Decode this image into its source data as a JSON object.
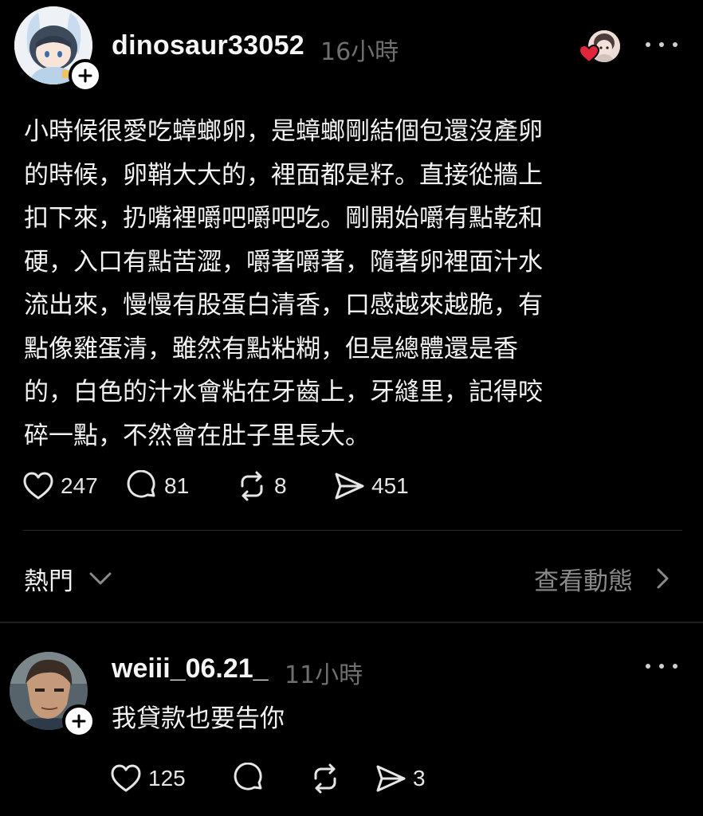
{
  "post": {
    "username": "dinosaur33052",
    "time": "16小時",
    "body": "小時候很愛吃蟑螂卵，是蟑螂剛結個包還沒產卵\n的時候，卵鞘大大的，裡面都是籽。直接從牆上\n扣下來，扔嘴裡嚼吧嚼吧吃。剛開始嚼有點乾和\n硬，入口有點苦澀，嚼著嚼著，隨著卵裡面汁水\n流出來，慢慢有股蛋白清香，口感越來越脆，有\n點像雞蛋清，雖然有點粘糊，但是總體還是香\n的，白色的汁水會粘在牙齒上，牙縫里，記得咬\n碎一點，不然會在肚子里長大。",
    "likes": "247",
    "comments": "81",
    "reposts": "8",
    "shares": "451"
  },
  "sort": {
    "label": "熱門",
    "activity_link": "查看動態"
  },
  "reply": {
    "username": "weiii_06.21_",
    "time": "11小時",
    "text": "我貸款也要告你",
    "likes": "125",
    "shares": "3"
  },
  "colors": {
    "background": "#000000",
    "text": "#f2f2f2",
    "muted": "#6f6f6f",
    "heart_badge": "#e0263a"
  }
}
